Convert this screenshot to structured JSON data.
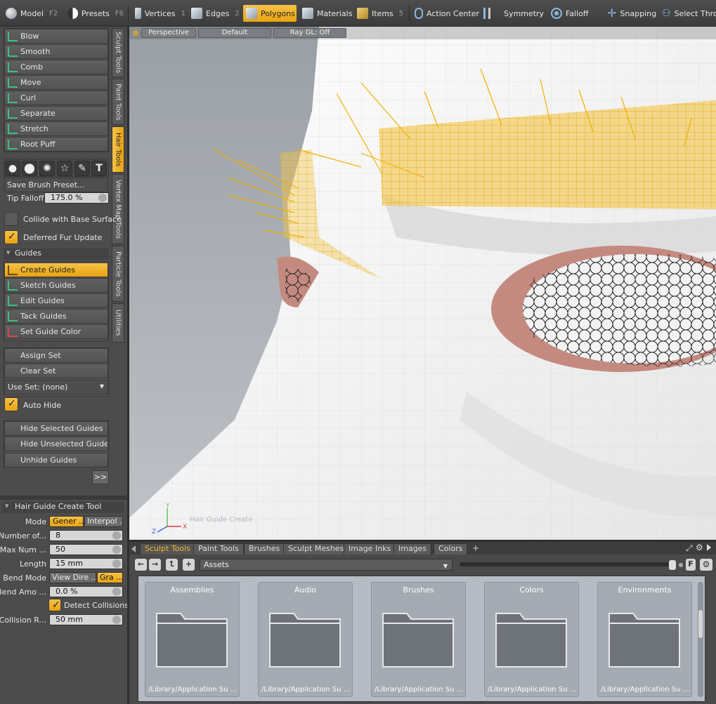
{
  "toolbar": {
    "model": {
      "label": "Model",
      "key": "F2"
    },
    "presets": {
      "label": "Presets",
      "key": "F6"
    },
    "vertices": {
      "label": "Vertices",
      "key": "1"
    },
    "edges": {
      "label": "Edges",
      "key": "2"
    },
    "polygons": {
      "label": "Polygons"
    },
    "materials": {
      "label": "Materials"
    },
    "items": {
      "label": "Items",
      "key": "5"
    },
    "action_center": {
      "label": "Action Center"
    },
    "symmetry": {
      "label": "Symmetry"
    },
    "falloff": {
      "label": "Falloff"
    },
    "snapping": {
      "label": "Snapping"
    },
    "select_through": {
      "label": "Select Throu"
    }
  },
  "side_tabs": [
    "Sculpt Tools",
    "Paint Tools",
    "Hair Tools",
    "Vertex Map Tools",
    "Particle Tools",
    "Utilities"
  ],
  "hair_tools": [
    "Blow",
    "Smooth",
    "Comb",
    "Move",
    "Curl",
    "Separate",
    "Stretch",
    "Root Puff"
  ],
  "brush": {
    "save_preset": "Save Brush Preset...",
    "tip_falloff_label": "Tip Falloff",
    "tip_falloff_value": "175.0 %"
  },
  "options": {
    "collide": "Collide with Base Surface",
    "deferred": "Deferred Fur Update"
  },
  "guides": {
    "section": "Guides",
    "items": [
      "Create Guides",
      "Sketch Guides",
      "Edit Guides",
      "Tack Guides",
      "Set Guide Color"
    ],
    "assign_set": "Assign Set",
    "clear_set": "Clear Set",
    "use_set": "Use Set: (none)",
    "auto_hide": "Auto Hide",
    "hide_selected": "Hide Selected Guides",
    "hide_unselected": "Hide Unselected Guides",
    "unhide": "Unhide Guides",
    "more": ">>"
  },
  "tool_props": {
    "title": "Hair Guide Create Tool",
    "mode_label": "Mode",
    "mode_a": "Gener ...",
    "mode_b": "Interpol ...",
    "number_label": "Number of...",
    "number_value": "8",
    "maxnum_label": "Max Num ...",
    "maxnum_value": "50",
    "length_label": "Length",
    "length_value": "15 mm",
    "bendmode_label": "Bend Mode",
    "bendmode_a": "View Dire ...",
    "bendmode_b": "Gra ...",
    "bendamo_label": "Bend Amo ...",
    "bendamo_value": "0.0 %",
    "detect_collisions": "Detect Collisions",
    "collision_label": "Collision R...",
    "collision_value": "50 mm"
  },
  "viewport": {
    "perspective": "Perspective",
    "default": "Default",
    "raygl": "Ray GL: Off",
    "tool_label": "Hair Guide Create",
    "axis_x": "X",
    "axis_y": "Y",
    "axis_z": "Z"
  },
  "browser": {
    "tabs": [
      "Sculpt Tools",
      "Paint Tools",
      "Brushes",
      "Sculpt Meshes",
      "Image Inks",
      "Images",
      "Colors"
    ],
    "add_tab": "+",
    "assets": "Assets",
    "filter": "F",
    "folders": [
      {
        "title": "Assemblies",
        "path": "/Library/Application Su ..."
      },
      {
        "title": "Audio",
        "path": "/Library/Application Su ..."
      },
      {
        "title": "Brushes",
        "path": "/Library/Application Su ..."
      },
      {
        "title": "Colors",
        "path": "/Library/Application Su ..."
      },
      {
        "title": "Environments",
        "path": "/Library/Application Su ..."
      }
    ]
  },
  "colors": {
    "accent": "#f0b42a",
    "hair": "#f0b000",
    "lid": "#c48a80"
  }
}
